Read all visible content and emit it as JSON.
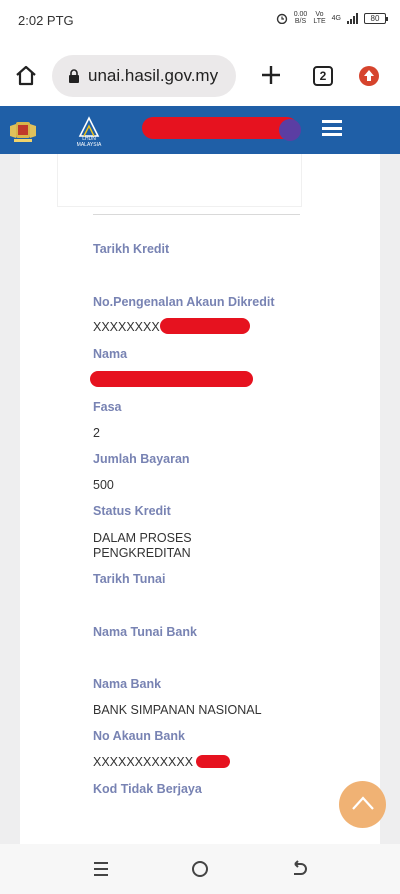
{
  "status_bar": {
    "time": "2:02 PTG",
    "net_speed": "0.00",
    "net_unit": "B/S",
    "volte_top": "Vo",
    "volte_bottom": "LTE",
    "network": "4G",
    "battery": "80"
  },
  "browser": {
    "url": "unai.hasil.gov.my",
    "tab_count": "2"
  },
  "site_header": {
    "logo_text_top": "LHDN",
    "logo_text_bottom": "MALAYSIA"
  },
  "details": {
    "tarikh_kredit": {
      "label": "Tarikh Kredit",
      "value": ""
    },
    "no_akaun_dikredit": {
      "label": "No.Pengenalan Akaun Dikredit",
      "value": "XXXXXXXX"
    },
    "nama": {
      "label": "Nama",
      "value": ""
    },
    "fasa": {
      "label": "Fasa",
      "value": "2"
    },
    "jumlah_bayaran": {
      "label": "Jumlah Bayaran",
      "value": "500"
    },
    "status_kredit": {
      "label": "Status Kredit",
      "value_line1": "DALAM PROSES",
      "value_line2": "PENGKREDITAN"
    },
    "tarikh_tunai": {
      "label": "Tarikh Tunai",
      "value": ""
    },
    "nama_tunai_bank": {
      "label": "Nama Tunai Bank",
      "value": ""
    },
    "nama_bank": {
      "label": "Nama Bank",
      "value": "BANK SIMPANAN NASIONAL"
    },
    "no_akaun_bank": {
      "label": "No Akaun Bank",
      "value": "XXXXXXXXXXXX"
    },
    "kod_tidak_berjaya": {
      "label": "Kod Tidak Berjaya",
      "value": ""
    }
  },
  "colors": {
    "header_blue": "#1f5fa7",
    "label": "#7883b3",
    "redaction": "#e6121f",
    "fab": "#f0b274"
  },
  "icons": [
    "home-icon",
    "lock-icon",
    "plus-icon",
    "tabs-icon",
    "update-icon",
    "menu-icon",
    "scroll-top-icon",
    "recents-icon",
    "home-circle-icon",
    "back-icon"
  ]
}
